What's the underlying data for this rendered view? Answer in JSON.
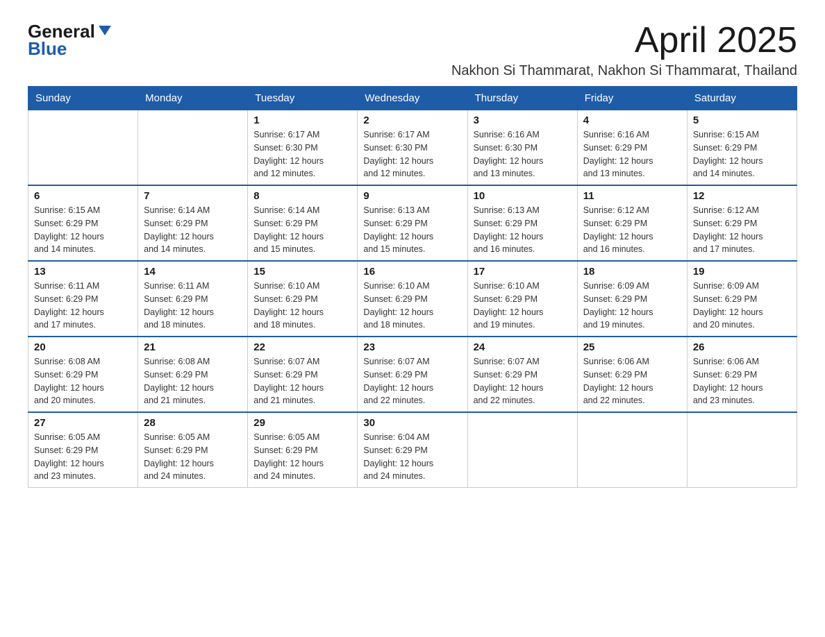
{
  "logo": {
    "general": "General",
    "blue": "Blue",
    "arrow_label": "arrow icon"
  },
  "header": {
    "month_title": "April 2025",
    "location": "Nakhon Si Thammarat, Nakhon Si Thammarat, Thailand"
  },
  "days_of_week": [
    "Sunday",
    "Monday",
    "Tuesday",
    "Wednesday",
    "Thursday",
    "Friday",
    "Saturday"
  ],
  "weeks": [
    [
      {
        "day": "",
        "info": ""
      },
      {
        "day": "",
        "info": ""
      },
      {
        "day": "1",
        "sunrise": "6:17 AM",
        "sunset": "6:30 PM",
        "daylight": "12 hours and 12 minutes."
      },
      {
        "day": "2",
        "sunrise": "6:17 AM",
        "sunset": "6:30 PM",
        "daylight": "12 hours and 12 minutes."
      },
      {
        "day": "3",
        "sunrise": "6:16 AM",
        "sunset": "6:30 PM",
        "daylight": "12 hours and 13 minutes."
      },
      {
        "day": "4",
        "sunrise": "6:16 AM",
        "sunset": "6:29 PM",
        "daylight": "12 hours and 13 minutes."
      },
      {
        "day": "5",
        "sunrise": "6:15 AM",
        "sunset": "6:29 PM",
        "daylight": "12 hours and 14 minutes."
      }
    ],
    [
      {
        "day": "6",
        "sunrise": "6:15 AM",
        "sunset": "6:29 PM",
        "daylight": "12 hours and 14 minutes."
      },
      {
        "day": "7",
        "sunrise": "6:14 AM",
        "sunset": "6:29 PM",
        "daylight": "12 hours and 14 minutes."
      },
      {
        "day": "8",
        "sunrise": "6:14 AM",
        "sunset": "6:29 PM",
        "daylight": "12 hours and 15 minutes."
      },
      {
        "day": "9",
        "sunrise": "6:13 AM",
        "sunset": "6:29 PM",
        "daylight": "12 hours and 15 minutes."
      },
      {
        "day": "10",
        "sunrise": "6:13 AM",
        "sunset": "6:29 PM",
        "daylight": "12 hours and 16 minutes."
      },
      {
        "day": "11",
        "sunrise": "6:12 AM",
        "sunset": "6:29 PM",
        "daylight": "12 hours and 16 minutes."
      },
      {
        "day": "12",
        "sunrise": "6:12 AM",
        "sunset": "6:29 PM",
        "daylight": "12 hours and 17 minutes."
      }
    ],
    [
      {
        "day": "13",
        "sunrise": "6:11 AM",
        "sunset": "6:29 PM",
        "daylight": "12 hours and 17 minutes."
      },
      {
        "day": "14",
        "sunrise": "6:11 AM",
        "sunset": "6:29 PM",
        "daylight": "12 hours and 18 minutes."
      },
      {
        "day": "15",
        "sunrise": "6:10 AM",
        "sunset": "6:29 PM",
        "daylight": "12 hours and 18 minutes."
      },
      {
        "day": "16",
        "sunrise": "6:10 AM",
        "sunset": "6:29 PM",
        "daylight": "12 hours and 18 minutes."
      },
      {
        "day": "17",
        "sunrise": "6:10 AM",
        "sunset": "6:29 PM",
        "daylight": "12 hours and 19 minutes."
      },
      {
        "day": "18",
        "sunrise": "6:09 AM",
        "sunset": "6:29 PM",
        "daylight": "12 hours and 19 minutes."
      },
      {
        "day": "19",
        "sunrise": "6:09 AM",
        "sunset": "6:29 PM",
        "daylight": "12 hours and 20 minutes."
      }
    ],
    [
      {
        "day": "20",
        "sunrise": "6:08 AM",
        "sunset": "6:29 PM",
        "daylight": "12 hours and 20 minutes."
      },
      {
        "day": "21",
        "sunrise": "6:08 AM",
        "sunset": "6:29 PM",
        "daylight": "12 hours and 21 minutes."
      },
      {
        "day": "22",
        "sunrise": "6:07 AM",
        "sunset": "6:29 PM",
        "daylight": "12 hours and 21 minutes."
      },
      {
        "day": "23",
        "sunrise": "6:07 AM",
        "sunset": "6:29 PM",
        "daylight": "12 hours and 22 minutes."
      },
      {
        "day": "24",
        "sunrise": "6:07 AM",
        "sunset": "6:29 PM",
        "daylight": "12 hours and 22 minutes."
      },
      {
        "day": "25",
        "sunrise": "6:06 AM",
        "sunset": "6:29 PM",
        "daylight": "12 hours and 22 minutes."
      },
      {
        "day": "26",
        "sunrise": "6:06 AM",
        "sunset": "6:29 PM",
        "daylight": "12 hours and 23 minutes."
      }
    ],
    [
      {
        "day": "27",
        "sunrise": "6:05 AM",
        "sunset": "6:29 PM",
        "daylight": "12 hours and 23 minutes."
      },
      {
        "day": "28",
        "sunrise": "6:05 AM",
        "sunset": "6:29 PM",
        "daylight": "12 hours and 24 minutes."
      },
      {
        "day": "29",
        "sunrise": "6:05 AM",
        "sunset": "6:29 PM",
        "daylight": "12 hours and 24 minutes."
      },
      {
        "day": "30",
        "sunrise": "6:04 AM",
        "sunset": "6:29 PM",
        "daylight": "12 hours and 24 minutes."
      },
      {
        "day": "",
        "info": ""
      },
      {
        "day": "",
        "info": ""
      },
      {
        "day": "",
        "info": ""
      }
    ]
  ],
  "labels": {
    "sunrise": "Sunrise: ",
    "sunset": "Sunset: ",
    "daylight": "Daylight: "
  }
}
